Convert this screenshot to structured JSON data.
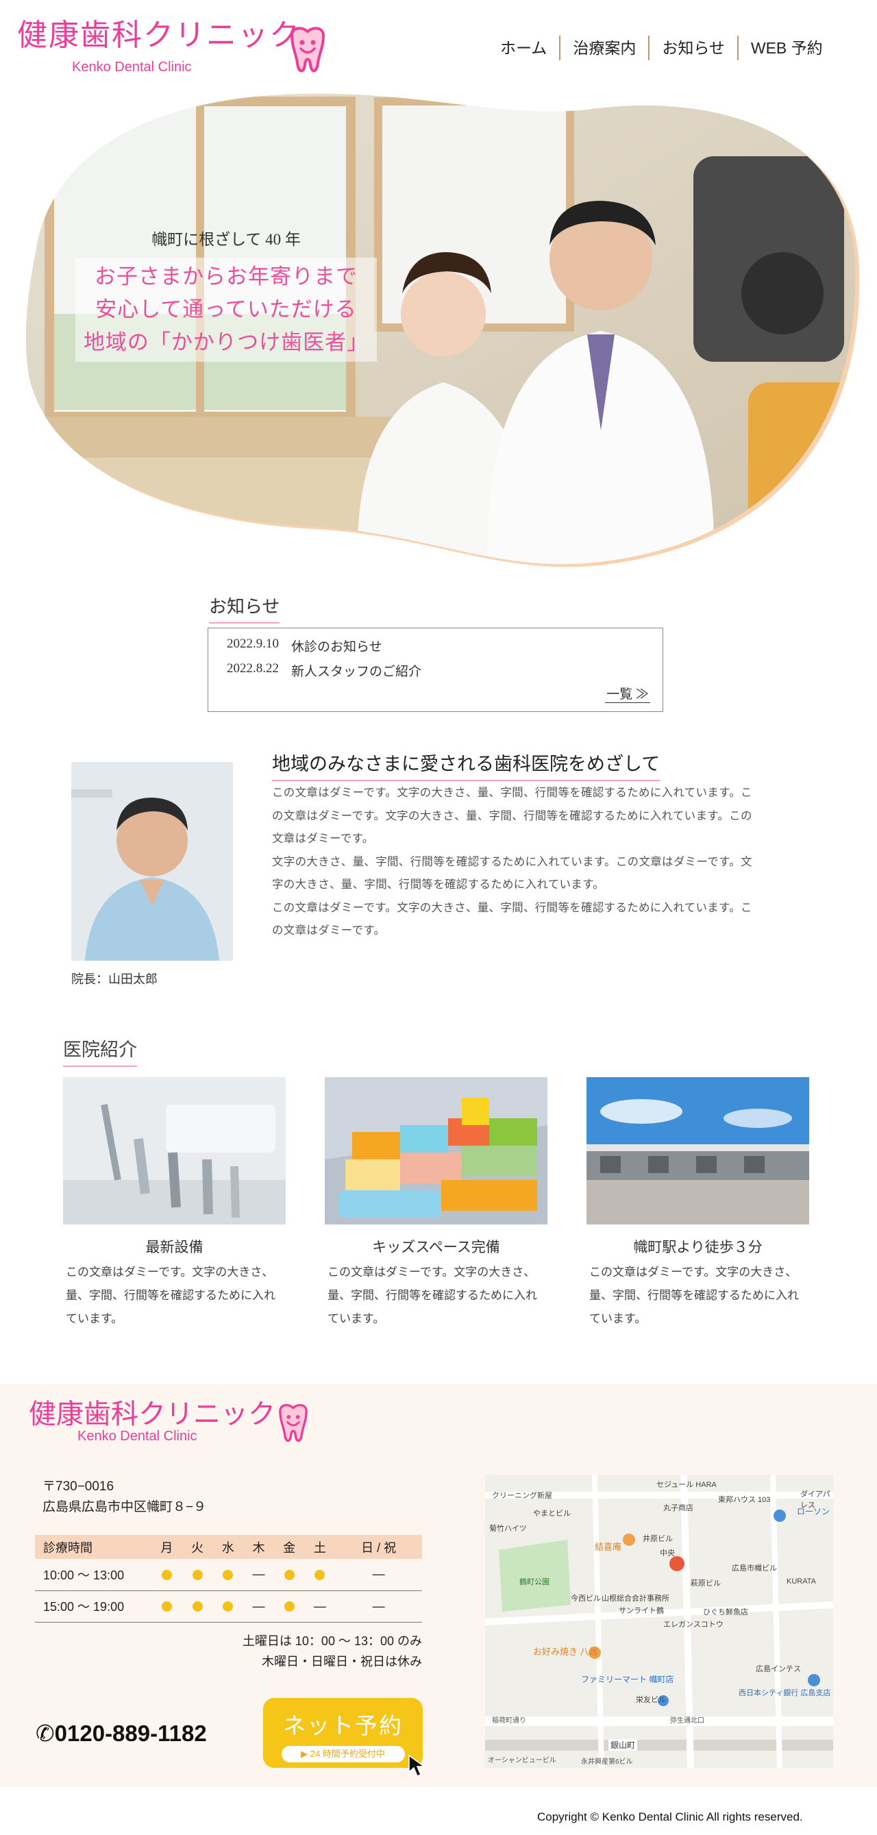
{
  "header": {
    "logo_jp": "健康歯科クリニック",
    "logo_en": "Kenko Dental Clinic",
    "nav": [
      "ホーム",
      "治療案内",
      "お知らせ",
      "WEB 予約"
    ]
  },
  "hero": {
    "sub": "幟町に根ざして 40 年",
    "lines": [
      "お子さまからお年寄りまで",
      "安心して通っていただける",
      "地域の「かかりつけ歯医者」"
    ]
  },
  "news": {
    "heading": "お知らせ",
    "items": [
      {
        "date": "2022.9.10",
        "title": "休診のお知らせ"
      },
      {
        "date": "2022.8.22",
        "title": "新人スタッフのご紹介"
      }
    ],
    "more": "一覧 ≫"
  },
  "intro": {
    "heading": "地域のみなさまに愛される歯科医院をめざして",
    "caption": "院長：山田太郎",
    "lines": [
      "この文章はダミーです。文字の大きさ、量、字間、行間等を確認するために入れています。こ",
      "の文章はダミーです。文字の大きさ、量、字間、行間等を確認するために入れています。この",
      "文章はダミーです。",
      "文字の大きさ、量、字間、行間等を確認するために入れています。この文章はダミーです。文",
      "字の大きさ、量、字間、行間等を確認するために入れています。",
      "この文章はダミーです。文字の大きさ、量、字間、行間等を確認するために入れています。こ",
      "の文章はダミーです。"
    ]
  },
  "clinic": {
    "heading": "医院紹介",
    "cards": [
      {
        "title": "最新設備",
        "lines": [
          "この文章はダミーです。文字の大きさ、",
          "量、字間、行間等を確認するために入れ",
          "ています。"
        ]
      },
      {
        "title": "キッズスペース完備",
        "lines": [
          "この文章はダミーです。文字の大きさ、",
          "量、字間、行間等を確認するために入れ",
          "ています。"
        ]
      },
      {
        "title": "幟町駅より徒歩３分",
        "lines": [
          "この文章はダミーです。文字の大きさ、",
          "量、字間、行間等を確認するために入れ",
          "ています。"
        ]
      }
    ]
  },
  "footer": {
    "logo_jp": "健康歯科クリニック",
    "logo_en": "Kenko Dental Clinic",
    "postal": "〒730−0016",
    "address": "広島県広島市中区幟町８−９",
    "hours_header": [
      "診療時間",
      "月",
      "火",
      "水",
      "木",
      "金",
      "土",
      "日 / 祝"
    ],
    "hours_rows": [
      {
        "time": "10:00 〜 13:00",
        "days": [
          "dot",
          "dot",
          "dot",
          "—",
          "dot",
          "dot",
          "—"
        ]
      },
      {
        "time": "15:00 〜 19:00",
        "days": [
          "dot",
          "dot",
          "dot",
          "—",
          "dot",
          "—",
          "—"
        ]
      }
    ],
    "notes": [
      "土曜日は 10：00 〜 13：00 のみ",
      "木曜日・日曜日・祝日は休み"
    ],
    "tel": "✆0120-889-1182",
    "web_btn": "ネット予約",
    "web_sub": "▶ 24 時間予約受付中",
    "map_labels": [
      "セジュール HARA",
      "クリーニング新屋",
      "丸子商店",
      "東邦ハウス 103",
      "ダイアパレス",
      "菊竹ハイツ",
      "やまとビル",
      "ローソン",
      "井原ビル",
      "中央",
      "広島市幟ビル",
      "結喜庵",
      "鶴町公園",
      "今西ビル",
      "山根総合会計事務所",
      "萩原ビル",
      "ひぐち鮮魚店",
      "サンライト鶴",
      "エレガンスコトウ",
      "お好み焼き 八昌",
      "ファミリーマート 幟町店",
      "栄友ビル",
      "西日本シティ銀行 広島支店",
      "広島インテス",
      "稲荷町通り",
      "弥生通北口",
      "銀山町",
      "オーシャンビュービル",
      "KURATA",
      "永井興産第6ビル"
    ],
    "copyright": "Copyright © Kenko Dental Clinic All rights reserved."
  },
  "colors": {
    "brand_pink": "#ea3f98",
    "accent_yellow": "#f5c518",
    "table_head": "#f8d6be"
  }
}
